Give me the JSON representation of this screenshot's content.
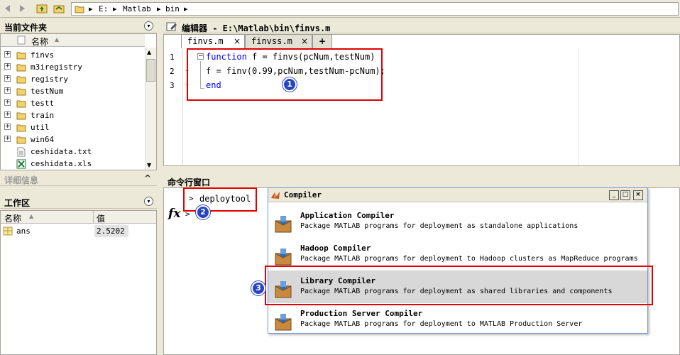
{
  "path": {
    "drive": "E:",
    "folder1": "Matlab",
    "folder2": "bin"
  },
  "current_folder": {
    "title": "当前文件夹",
    "column_name": "名称",
    "sort_marker": "▲",
    "items": [
      {
        "name": "finvs",
        "type": "folder"
      },
      {
        "name": "m3iregistry",
        "type": "folder"
      },
      {
        "name": "registry",
        "type": "folder"
      },
      {
        "name": "testNum",
        "type": "folder"
      },
      {
        "name": "testt",
        "type": "folder"
      },
      {
        "name": "train",
        "type": "folder"
      },
      {
        "name": "util",
        "type": "folder"
      },
      {
        "name": "win64",
        "type": "folder"
      },
      {
        "name": "ceshidata.txt",
        "type": "txt"
      },
      {
        "name": "ceshidata.xls",
        "type": "xls"
      }
    ]
  },
  "details": {
    "title": "详细信息"
  },
  "workspace": {
    "title": "工作区",
    "col_name": "名称",
    "sort_marker": "▲",
    "col_value": "值",
    "rows": [
      {
        "name": "ans",
        "value": "2.5202"
      }
    ]
  },
  "editor": {
    "title": "编辑器 - E:\\Matlab\\bin\\finvs.m",
    "tabs": [
      {
        "label": "finvs.m",
        "close": "×"
      },
      {
        "label": "finvss.m",
        "close": "×"
      }
    ],
    "add_tab": "+",
    "line_numbers": [
      "1",
      "2",
      "3"
    ],
    "line1_kw": "function",
    "line1_rest": " f = finvs(pcNum,testNum)",
    "line2": "f = finv(0.99,pcNum,testNum-pcNum);",
    "line3_kw": "end",
    "fold_marker": "−"
  },
  "command": {
    "title": "命令行窗口",
    "prompt": ">",
    "input": "deploytool",
    "fx": "fx",
    "prompt2": ">"
  },
  "compiler": {
    "title": "Compiler",
    "items": [
      {
        "title": "Application Compiler",
        "desc": "Package MATLAB programs for deployment as standalone applications"
      },
      {
        "title": "Hadoop Compiler",
        "desc": "Package MATLAB programs for deployment to Hadoop clusters as MapReduce programs"
      },
      {
        "title": "Library Compiler",
        "desc": "Package MATLAB programs for deployment as shared libraries and components"
      },
      {
        "title": "Production Server Compiler",
        "desc": "Package MATLAB programs for deployment to MATLAB Production Server"
      }
    ]
  },
  "badges": [
    "1",
    "2",
    "3"
  ],
  "colors": {
    "highlight": "#e00000",
    "badge": "#2744c4",
    "keyword": "#0000ff"
  }
}
